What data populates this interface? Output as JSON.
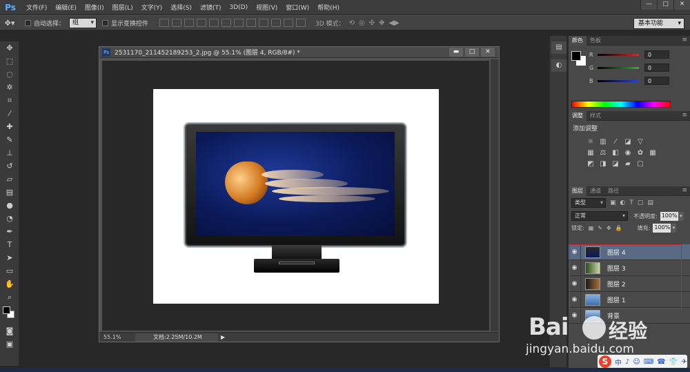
{
  "menubar": {
    "logo": "Ps",
    "items": [
      "文件(F)",
      "编辑(E)",
      "图像(I)",
      "图层(L)",
      "文字(Y)",
      "选择(S)",
      "滤镜(T)",
      "3D(D)",
      "视图(V)",
      "窗口(W)",
      "帮助(H)"
    ],
    "window_controls": [
      "—",
      "□",
      "✕"
    ]
  },
  "optionsbar": {
    "auto_select_label": "自动选择：",
    "auto_select_value": "组",
    "show_transform_label": "显示变换控件",
    "mode3d_label": "3D 模式：",
    "workspace": "基本功能"
  },
  "document": {
    "title": "2531170_211452189253_2.jpg @ 55.1% (图层 4, RGB/8#) *",
    "zoom": "55.1%",
    "doc_info": "文档:2.25M/10.2M"
  },
  "color_panel": {
    "tabs": [
      "颜色",
      "色板"
    ],
    "channels": [
      {
        "label": "R",
        "value": "0",
        "color": "#c83030"
      },
      {
        "label": "G",
        "value": "0",
        "color": "#30b030"
      },
      {
        "label": "B",
        "value": "0",
        "color": "#3040d0"
      }
    ]
  },
  "adjust_panel": {
    "tabs": [
      "调整",
      "样式"
    ],
    "title": "添加调整"
  },
  "layers_panel": {
    "tabs": [
      "图层",
      "通道",
      "路径"
    ],
    "filter_kind": "类型",
    "blend_mode": "正常",
    "opacity_label": "不透明度:",
    "opacity_value": "100%",
    "lock_label": "锁定:",
    "fill_label": "填充:",
    "fill_value": "100%",
    "layers": [
      {
        "name": "图层 4",
        "selected": true
      },
      {
        "name": "图层 3",
        "selected": false
      },
      {
        "name": "图层 2",
        "selected": false
      },
      {
        "name": "图层 1",
        "selected": false
      },
      {
        "name": "背景",
        "selected": false
      }
    ]
  },
  "watermark": {
    "brand": "Bai",
    "brand2": "经验",
    "url": "jingyan.baidu.com"
  },
  "ime": {
    "logo": "S",
    "items": [
      "中",
      "♪",
      "☺",
      "⌨",
      "☎",
      "👕",
      "✈"
    ]
  }
}
